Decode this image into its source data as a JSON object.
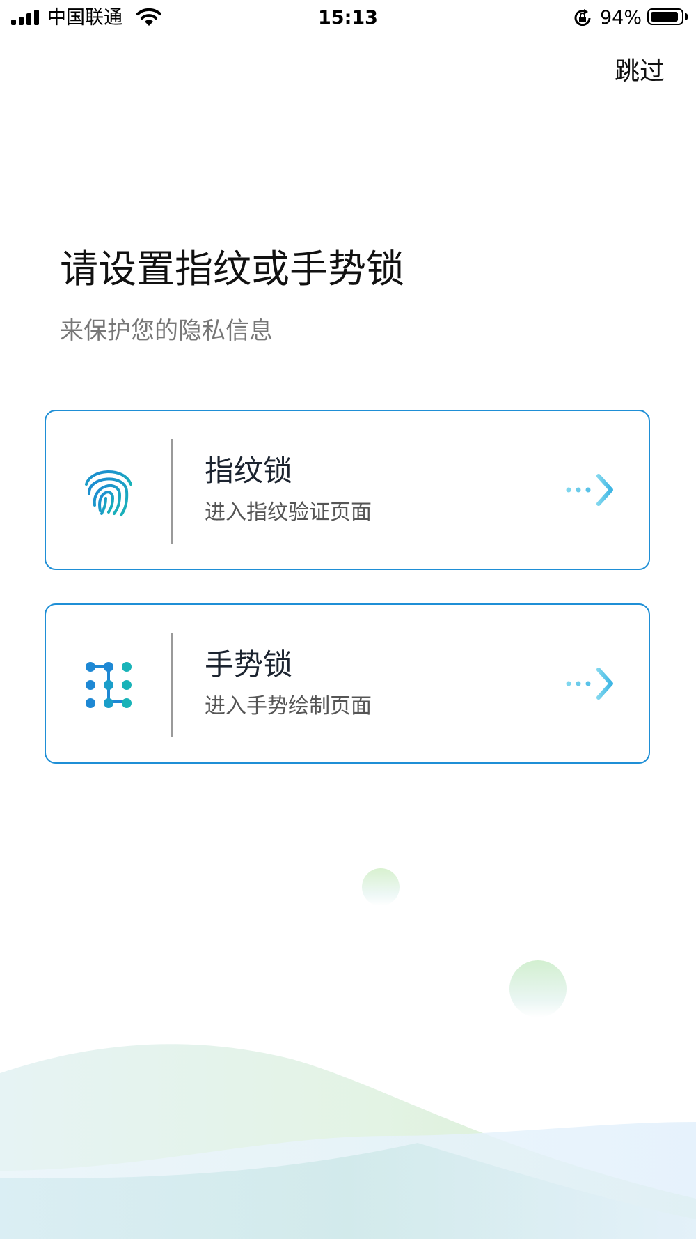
{
  "status_bar": {
    "carrier": "中国联通",
    "time": "15:13",
    "battery_percent": "94%",
    "battery_level": 0.94,
    "signal_icon": "signal-bars-icon",
    "wifi_icon": "wifi-icon",
    "rotation_lock_icon": "rotation-lock-icon",
    "battery_icon": "battery-icon"
  },
  "header": {
    "skip_label": "跳过"
  },
  "main": {
    "title": "请设置指纹或手势锁",
    "subtitle": "来保护您的隐私信息"
  },
  "options": [
    {
      "label": "指纹锁",
      "description": "进入指纹验证页面",
      "icon": "fingerprint-icon",
      "arrow_icon": "arrow-right-icon"
    },
    {
      "label": "手势锁",
      "description": "进入手势绘制页面",
      "icon": "gesture-pattern-icon",
      "arrow_icon": "arrow-right-icon"
    }
  ],
  "colors": {
    "accent": "#1f8fd6",
    "icon_blue": "#1e88d4",
    "icon_teal": "#19b3b8",
    "arrow": "#4fc3e8"
  }
}
